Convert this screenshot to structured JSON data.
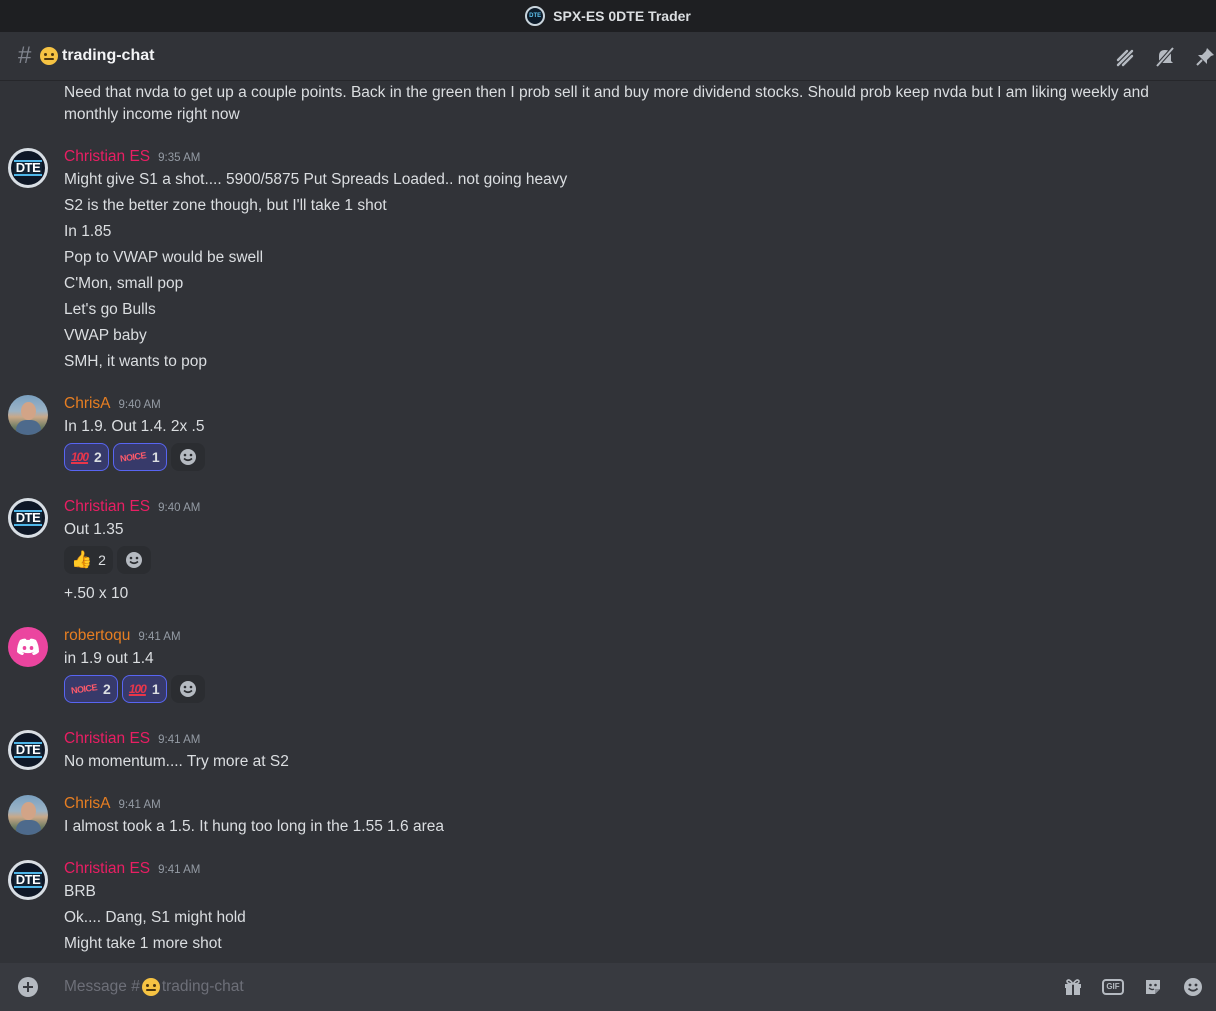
{
  "window": {
    "title": "SPX-ES 0DTE Trader",
    "server_icon_text": "DTE"
  },
  "channel": {
    "name": "trading-chat",
    "hash": "#"
  },
  "first_message": {
    "text": "Need that nvda to get up a couple points.  Back in the green then I prob sell it and buy more dividend stocks.   Should prob keep nvda but I am liking weekly and monthly income right now"
  },
  "messages": [
    {
      "author": "Christian ES",
      "timestamp": "9:35 AM",
      "avatar": "DTE",
      "lines": [
        "Might  give S1 a shot....  5900/5875 Put Spreads Loaded.. not going heavy",
        "S2 is the better zone though, but I'll take 1 shot",
        "In 1.85",
        "Pop to VWAP would be swell",
        "C'Mon, small pop",
        "Let's go Bulls",
        "VWAP baby",
        "SMH, it wants to pop"
      ]
    },
    {
      "author": "ChrisA",
      "timestamp": "9:40 AM",
      "lines": [
        "In 1.9. Out 1.4. 2x .5"
      ],
      "reactions": [
        {
          "emoji": "100",
          "count": "2"
        },
        {
          "emoji": "NOICE",
          "count": "1"
        }
      ]
    },
    {
      "author": "Christian ES",
      "timestamp": "9:40 AM",
      "avatar": "DTE",
      "lines": [
        "Out 1.35",
        "+.50 x 10"
      ],
      "reactions": [
        {
          "emoji": "👍",
          "count": "2"
        }
      ]
    },
    {
      "author": "robertoqu",
      "timestamp": "9:41 AM",
      "lines": [
        "in 1.9 out 1.4"
      ],
      "reactions": [
        {
          "emoji": "NOICE",
          "count": "2"
        },
        {
          "emoji": "100",
          "count": "1"
        }
      ]
    },
    {
      "author": "Christian ES",
      "timestamp": "9:41 AM",
      "avatar": "DTE",
      "lines": [
        "No momentum.... Try more at S2"
      ]
    },
    {
      "author": "ChrisA",
      "timestamp": "9:41 AM",
      "lines": [
        "I almost took a 1.5.  It hung too long in the 1.55 1.6 area"
      ]
    },
    {
      "author": "Christian ES",
      "timestamp": "9:41 AM",
      "avatar": "DTE",
      "lines": [
        "BRB",
        "Ok.... Dang, S1 might hold",
        "Might take 1 more shot"
      ]
    }
  ],
  "composer": {
    "placeholder_prefix": "Message #",
    "placeholder_channel": "trading-chat"
  },
  "colors": {
    "author_red": "#e91e63",
    "author_orange": "#e67e22",
    "reaction_active": "#5865f2"
  }
}
